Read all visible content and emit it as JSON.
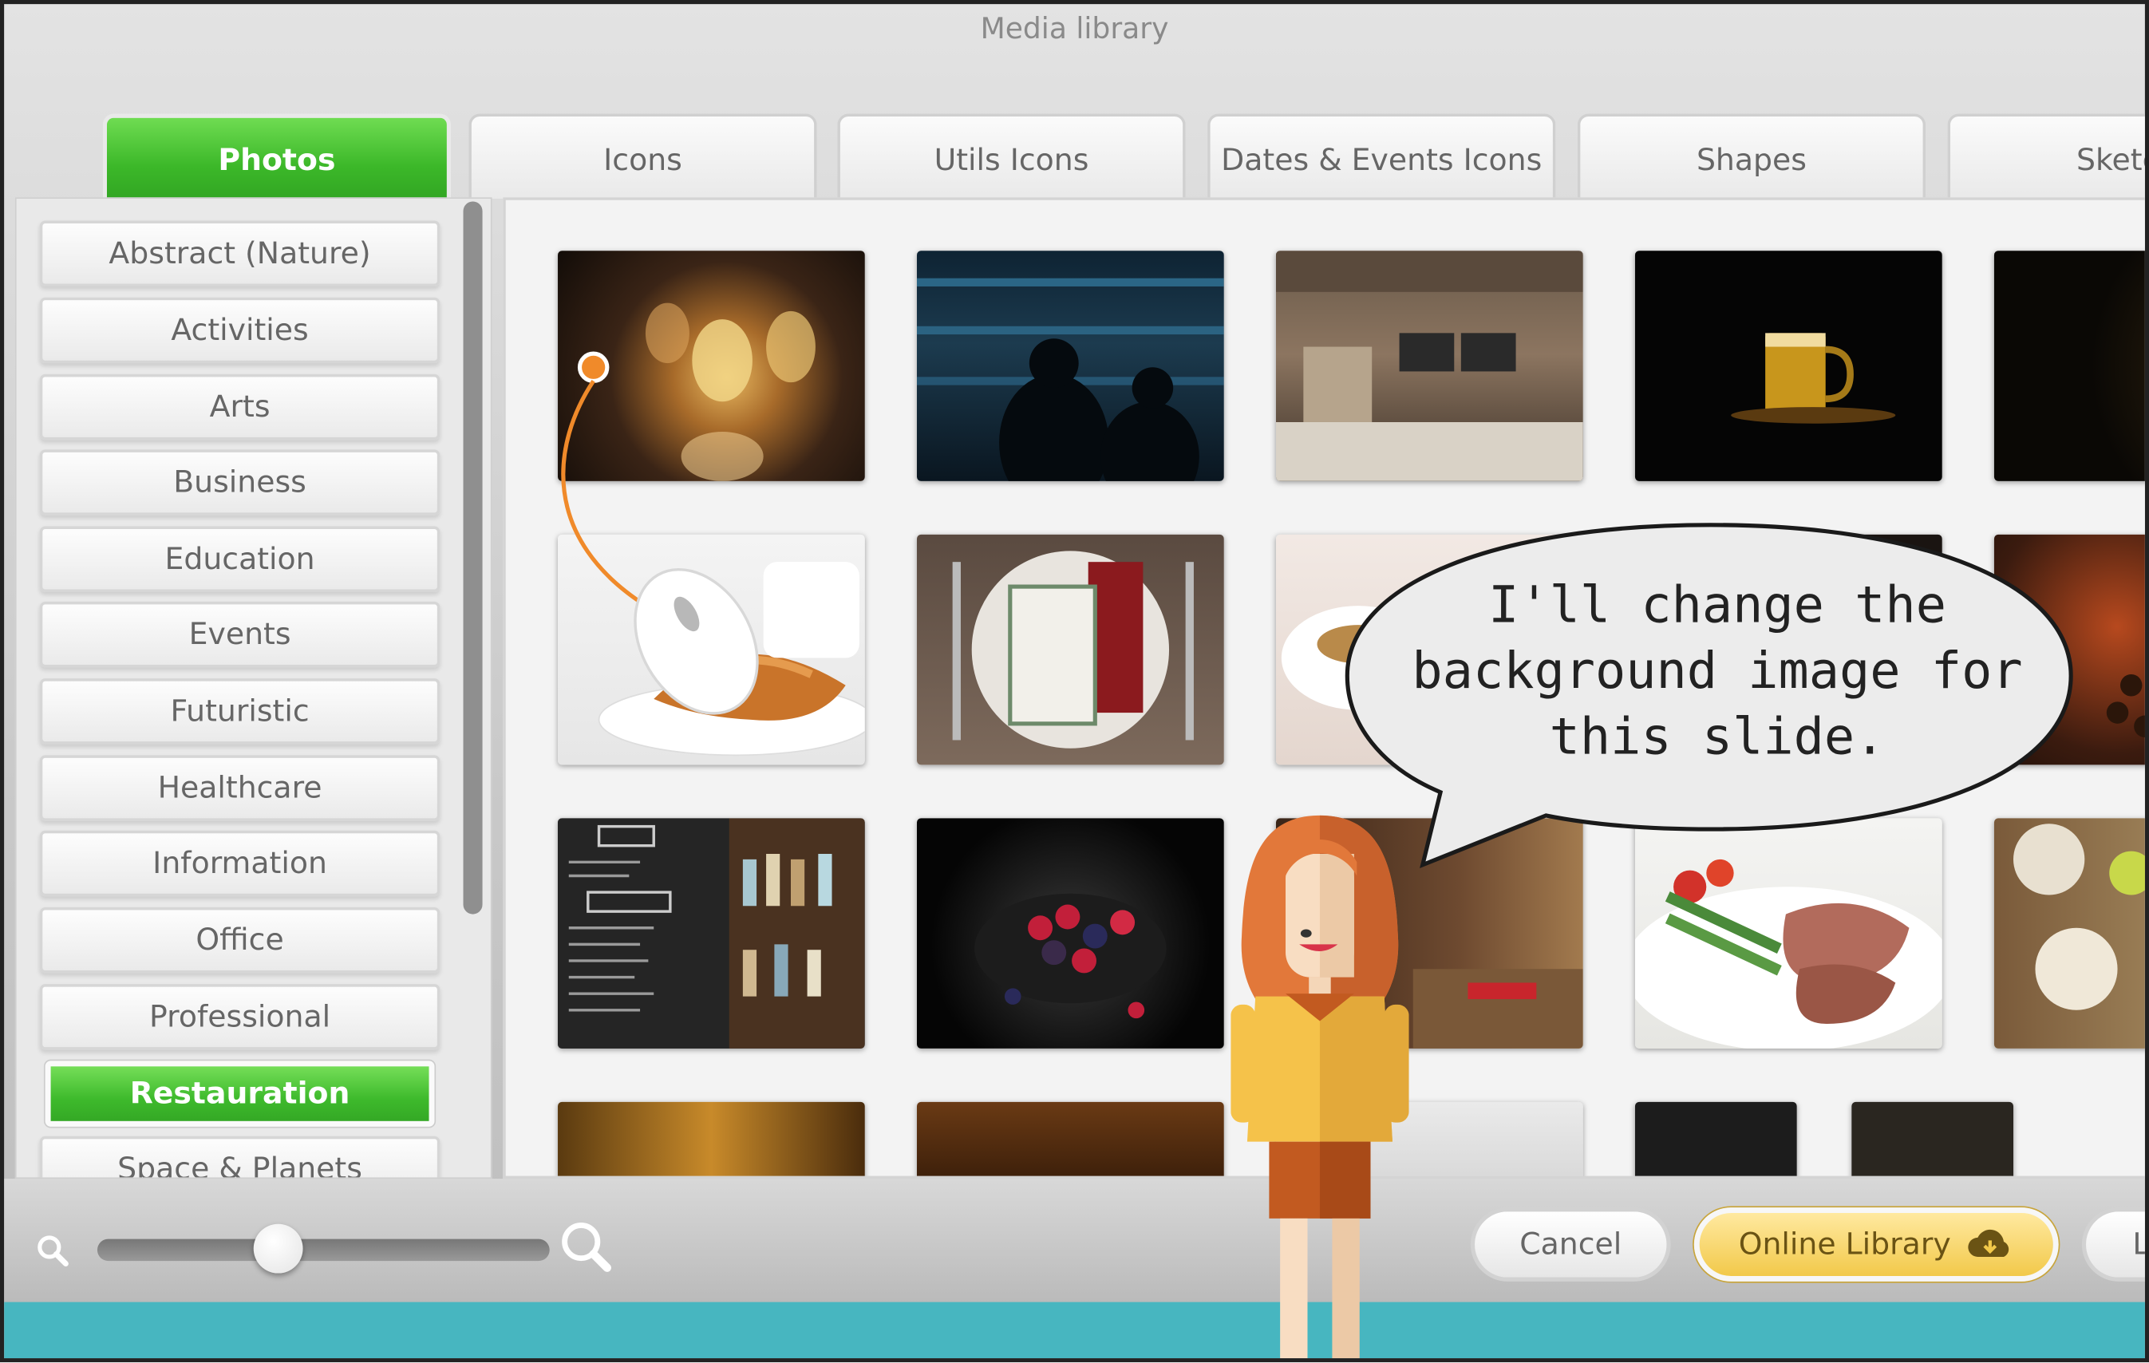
{
  "window": {
    "title": "Media library"
  },
  "tabs": [
    {
      "label": "Photos",
      "active": true
    },
    {
      "label": "Icons"
    },
    {
      "label": "Utils Icons"
    },
    {
      "label": "Dates & Events Icons"
    },
    {
      "label": "Shapes"
    },
    {
      "label": "Sketc"
    }
  ],
  "categories": [
    {
      "label": "Abstract (Nature)"
    },
    {
      "label": "Activities"
    },
    {
      "label": "Arts"
    },
    {
      "label": "Business"
    },
    {
      "label": "Education"
    },
    {
      "label": "Events"
    },
    {
      "label": "Futuristic"
    },
    {
      "label": "Healthcare"
    },
    {
      "label": "Information"
    },
    {
      "label": "Office"
    },
    {
      "label": "Professional"
    },
    {
      "label": "Restauration",
      "active": true
    },
    {
      "label": "Space & Planets"
    }
  ],
  "buttons": {
    "cancel": "Cancel",
    "online_library": "Online Library",
    "third": "L"
  },
  "zoom": {
    "level": 0.4
  },
  "speech_bubble": {
    "line1": "I'll change the",
    "line2": "background image for",
    "line3": "this slide."
  },
  "colors": {
    "active_green": "#3cb829",
    "online_yellow": "#f2c94a",
    "teal": "#47b6c0"
  },
  "icons": {
    "zoom_out": "magnifier-small-icon",
    "zoom_in": "magnifier-large-icon",
    "online": "cloud-download-icon",
    "cursor": "mouse-icon"
  }
}
